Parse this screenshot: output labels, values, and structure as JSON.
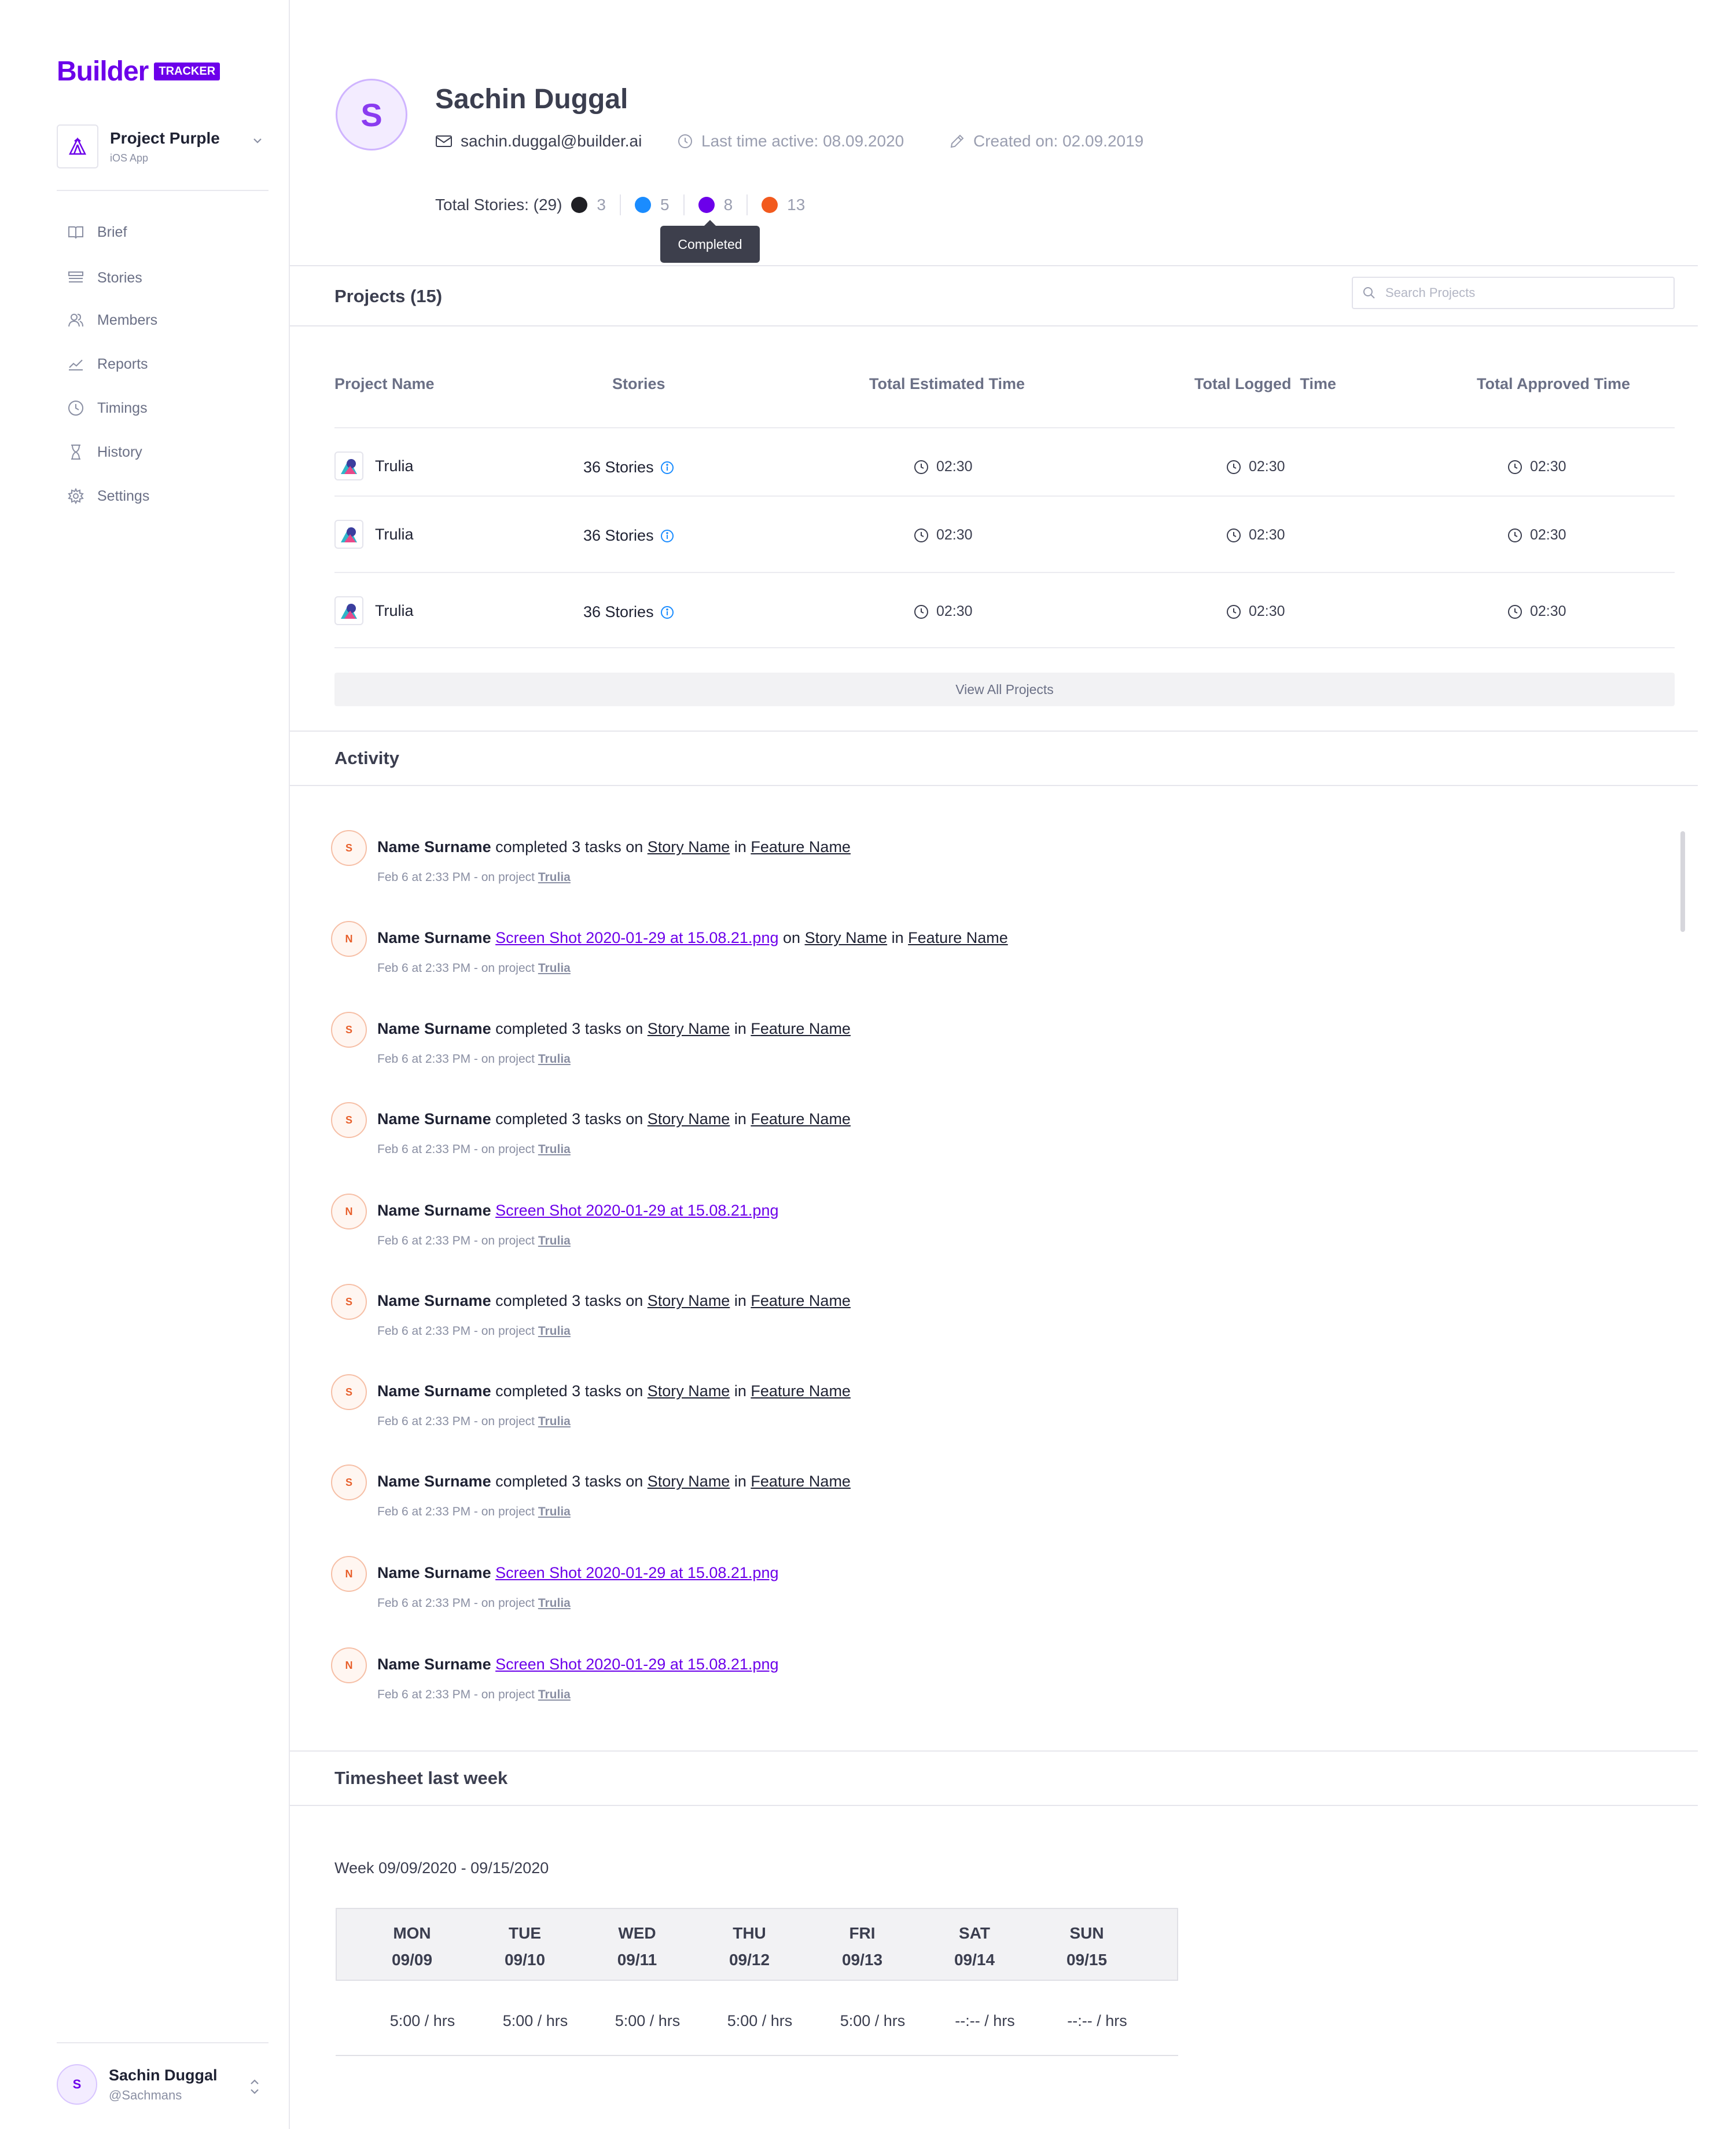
{
  "brand": {
    "word": "Builder",
    "badge": "TRACKER",
    "color": "#6c00ea"
  },
  "project": {
    "name": "Project Purple",
    "platform": "iOS App"
  },
  "sidebar": {
    "items": [
      {
        "label": "Brief",
        "icon": "book-icon"
      },
      {
        "label": "Stories",
        "icon": "list-icon"
      },
      {
        "label": "Members",
        "icon": "members-icon"
      },
      {
        "label": "Reports",
        "icon": "chart-line-icon"
      },
      {
        "label": "Timings",
        "icon": "clock-icon"
      },
      {
        "label": "History",
        "icon": "hourglass-icon"
      },
      {
        "label": "Settings",
        "icon": "gear-icon"
      }
    ]
  },
  "current_user": {
    "initial": "S",
    "name": "Sachin Duggal",
    "handle": "@Sachmans"
  },
  "profile": {
    "initial": "S",
    "name": "Sachin Duggal",
    "email": "sachin.duggal@builder.ai",
    "last_active": "Last time active: 08.09.2020",
    "created": "Created on: 02.09.2019",
    "total_stories_label": "Total Stories: (29)",
    "story_counts": [
      {
        "value": "3",
        "color": "#1f1f24"
      },
      {
        "value": "5",
        "color": "#1a8cff"
      },
      {
        "value": "8",
        "color": "#6c00ea"
      },
      {
        "value": "13",
        "color": "#f25a1e"
      }
    ],
    "tooltip": "Completed"
  },
  "projects": {
    "title": "Projects (15)",
    "search_placeholder": "Search Projects",
    "columns": [
      "Project Name",
      "Stories",
      "Total Estimated Time",
      "Total Logged  Time",
      "Total Approved Time"
    ],
    "rows": [
      {
        "name": "Trulia",
        "stories": "36 Stories",
        "estimated": "02:30",
        "logged": "02:30",
        "approved": "02:30"
      },
      {
        "name": "Trulia",
        "stories": "36 Stories",
        "estimated": "02:30",
        "logged": "02:30",
        "approved": "02:30"
      },
      {
        "name": "Trulia",
        "stories": "36 Stories",
        "estimated": "02:30",
        "logged": "02:30",
        "approved": "02:30"
      }
    ],
    "view_all": "View All Projects"
  },
  "activity": {
    "title": "Activity",
    "items": [
      {
        "initial": "S",
        "name": "Name Surname",
        "text": "completed 3 tasks on",
        "story": "Story Name",
        "in": "in",
        "feature": "Feature Name",
        "meta": "Feb 6 at 2:33 PM - on project",
        "project": "Trulia"
      },
      {
        "initial": "N",
        "name": "Name Surname",
        "file": "Screen Shot 2020-01-29 at 15.08.21.png",
        "on": "on",
        "story": "Story Name",
        "in": "in",
        "feature": "Feature Name",
        "meta": "Feb 6 at 2:33 PM - on project",
        "project": "Trulia"
      },
      {
        "initial": "S",
        "name": "Name Surname",
        "text": "completed 3 tasks on",
        "story": "Story Name",
        "in": "in",
        "feature": "Feature Name",
        "meta": "Feb 6 at 2:33 PM - on project",
        "project": "Trulia"
      },
      {
        "initial": "S",
        "name": "Name Surname",
        "text": "completed 3 tasks on",
        "story": "Story Name",
        "in": "in",
        "feature": "Feature Name",
        "meta": "Feb 6 at 2:33 PM - on project",
        "project": "Trulia"
      },
      {
        "initial": "N",
        "name": "Name Surname",
        "file": "Screen Shot 2020-01-29 at 15.08.21.png",
        "meta": "Feb 6 at 2:33 PM - on project",
        "project": "Trulia"
      },
      {
        "initial": "S",
        "name": "Name Surname",
        "text": "completed 3 tasks on",
        "story": "Story Name",
        "in": "in",
        "feature": "Feature Name",
        "meta": "Feb 6 at 2:33 PM - on project",
        "project": "Trulia"
      },
      {
        "initial": "S",
        "name": "Name Surname",
        "text": "completed 3 tasks on",
        "story": "Story Name",
        "in": "in",
        "feature": "Feature Name",
        "meta": "Feb 6 at 2:33 PM - on project",
        "project": "Trulia"
      },
      {
        "initial": "S",
        "name": "Name Surname",
        "text": "completed 3 tasks on",
        "story": "Story Name",
        "in": "in",
        "feature": "Feature Name",
        "meta": "Feb 6 at 2:33 PM - on project",
        "project": "Trulia"
      },
      {
        "initial": "N",
        "name": "Name Surname",
        "file": "Screen Shot 2020-01-29 at 15.08.21.png",
        "meta": "Feb 6 at 2:33 PM - on project",
        "project": "Trulia"
      },
      {
        "initial": "N",
        "name": "Name Surname",
        "file": "Screen Shot 2020-01-29 at 15.08.21.png",
        "meta": "Feb 6 at 2:33 PM - on project",
        "project": "Trulia"
      }
    ]
  },
  "timesheet": {
    "title": "Timesheet last week",
    "week": "Week 09/09/2020 - 09/15/2020",
    "days": [
      {
        "day": "MON",
        "date": "09/09",
        "value": "5:00 / hrs"
      },
      {
        "day": "TUE",
        "date": "09/10",
        "value": "5:00 / hrs"
      },
      {
        "day": "WED",
        "date": "09/11",
        "value": "5:00 / hrs"
      },
      {
        "day": "THU",
        "date": "09/12",
        "value": "5:00 / hrs"
      },
      {
        "day": "FRI",
        "date": "09/13",
        "value": "5:00 / hrs"
      },
      {
        "day": "SAT",
        "date": "09/14",
        "value": "--:-- / hrs"
      },
      {
        "day": "SUN",
        "date": "09/15",
        "value": "--:-- / hrs"
      }
    ]
  }
}
